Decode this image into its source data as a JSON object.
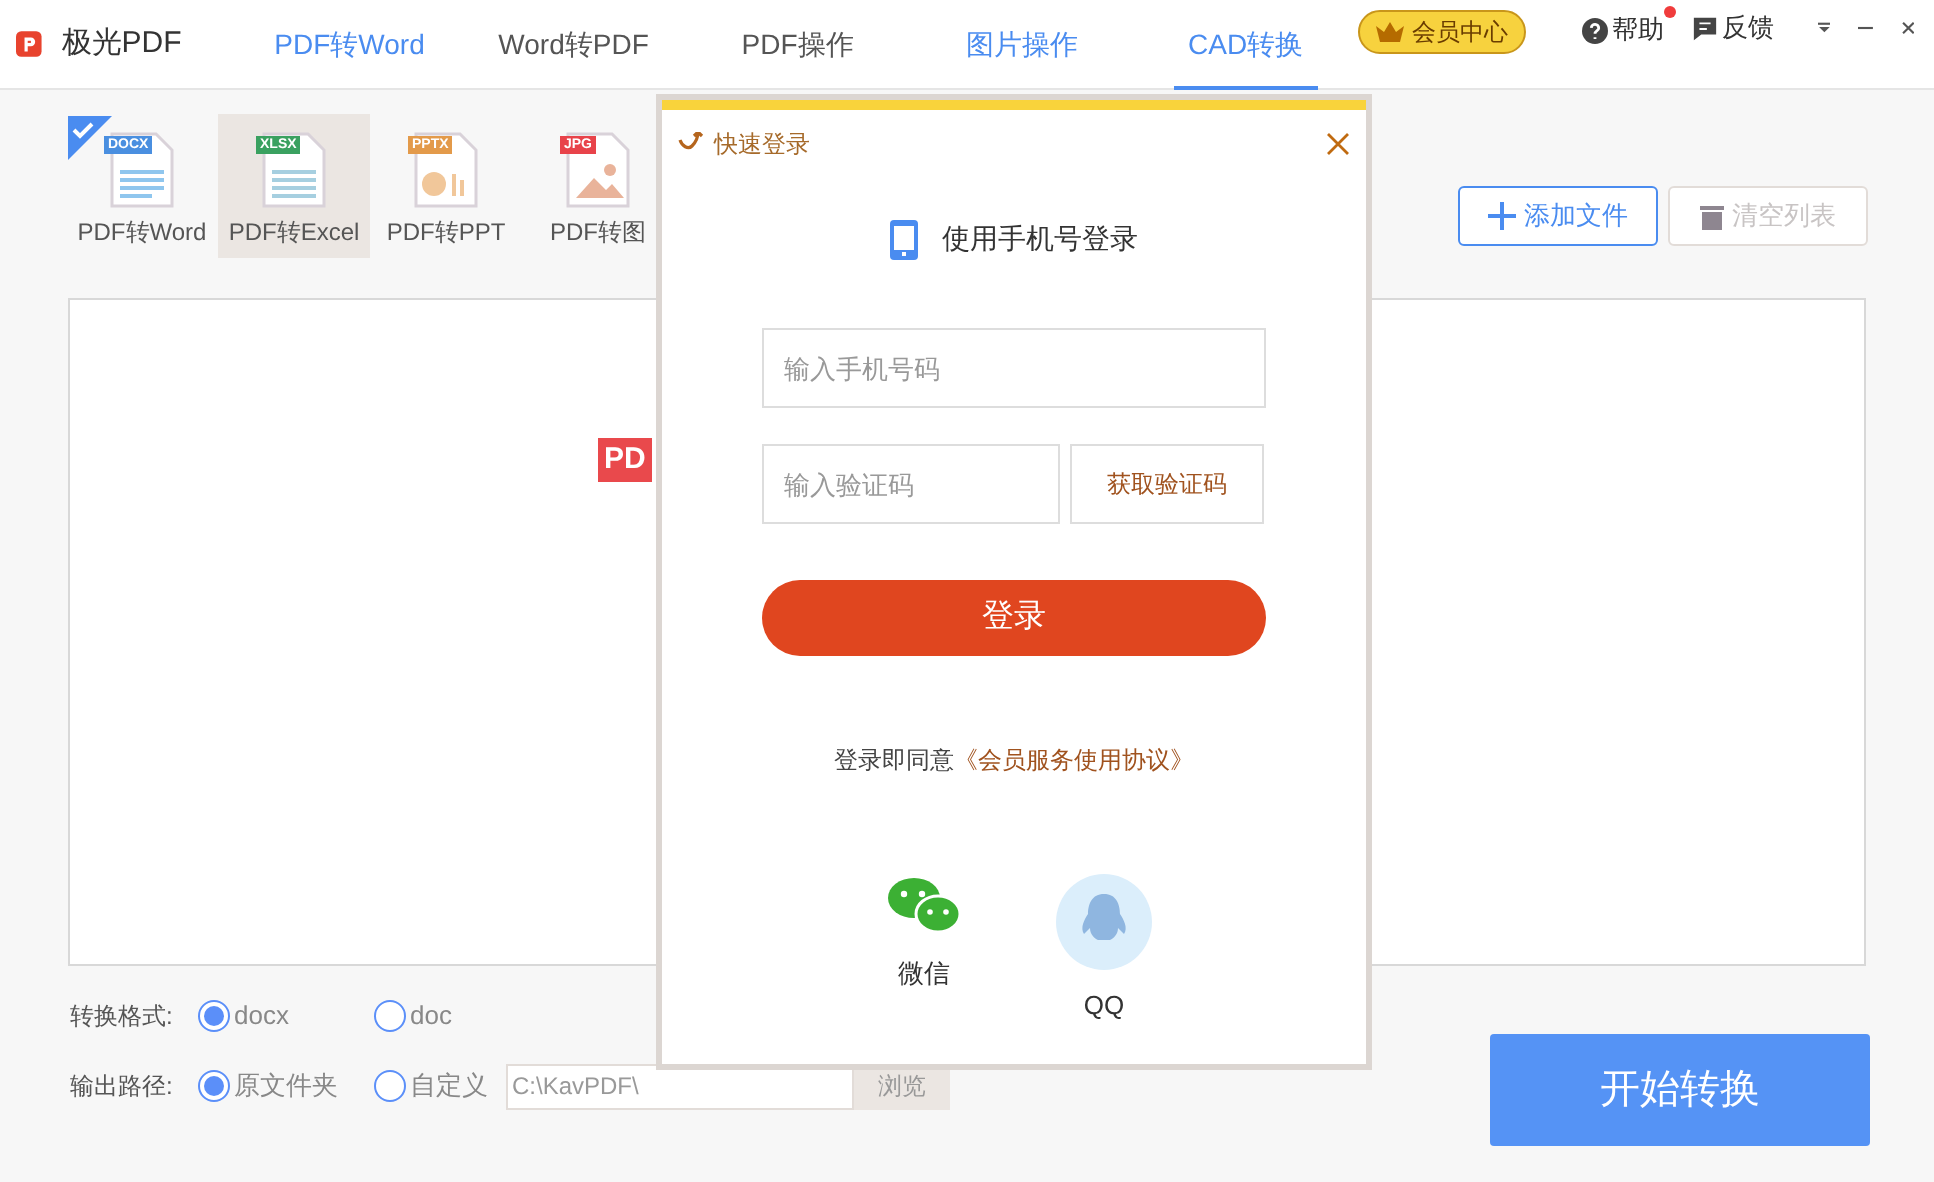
{
  "app": {
    "title": "极光PDF"
  },
  "tabs": [
    {
      "label": "PDF转Word",
      "selected": false,
      "accent": true
    },
    {
      "label": "Word转PDF",
      "selected": false,
      "accent": false
    },
    {
      "label": "PDF操作",
      "selected": false,
      "accent": false
    },
    {
      "label": "图片操作",
      "selected": false,
      "accent": true
    },
    {
      "label": "CAD转换",
      "selected": true,
      "accent": true
    }
  ],
  "vip": {
    "label": "会员中心"
  },
  "help": {
    "label": "帮助",
    "badge": true
  },
  "feedback": {
    "label": "反馈"
  },
  "tools": [
    {
      "label": "PDF转Word",
      "tag": "DOCX",
      "kind": "word",
      "selected": true,
      "hovered": false
    },
    {
      "label": "PDF转Excel",
      "tag": "XLSX",
      "kind": "excel",
      "selected": false,
      "hovered": true
    },
    {
      "label": "PDF转PPT",
      "tag": "PPTX",
      "kind": "ppt",
      "selected": false,
      "hovered": false
    },
    {
      "label": "PDF转图",
      "tag": "JPG",
      "kind": "image",
      "selected": false,
      "hovered": false
    }
  ],
  "actions": [
    {
      "label": "添加文件",
      "disabled": false
    },
    {
      "label": "清空列表",
      "disabled": true
    }
  ],
  "dropzone": {
    "badge": "PD"
  },
  "format": {
    "label": "转换格式:",
    "options": [
      {
        "label": "docx",
        "selected": true
      },
      {
        "label": "doc",
        "selected": false
      }
    ]
  },
  "output": {
    "label": "输出路径:",
    "options": [
      {
        "label": "原文件夹",
        "selected": true
      },
      {
        "label": "自定义",
        "selected": false
      }
    ],
    "path": "C:\\KavPDF\\",
    "browse": "浏览"
  },
  "start": {
    "label": "开始转换"
  },
  "login": {
    "title": "快速登录",
    "heading": "使用手机号登录",
    "phone_placeholder": "输入手机号码",
    "code_placeholder": "输入验证码",
    "get_code": "获取验证码",
    "submit": "登录",
    "agreement": "登录即同意",
    "agreement_link": "《会员服务使用协议》",
    "socials": [
      {
        "label": "微信",
        "kind": "wechat"
      },
      {
        "label": "QQ",
        "kind": "qq"
      }
    ]
  }
}
